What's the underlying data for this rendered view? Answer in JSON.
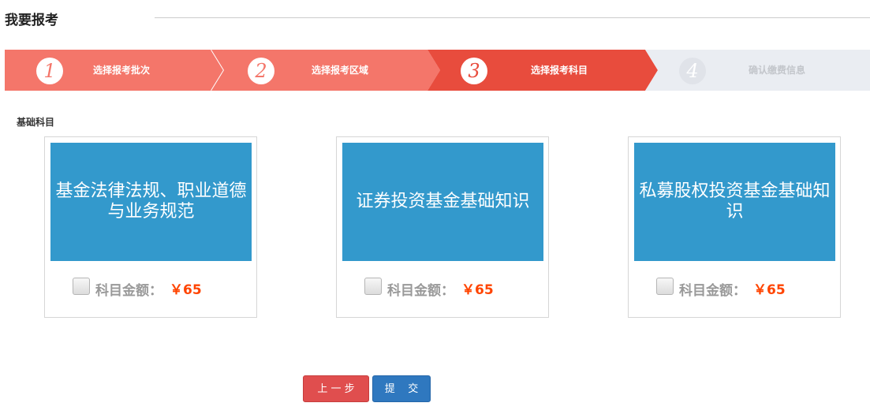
{
  "page_title": "我要报考",
  "steps": [
    {
      "number": "1",
      "label": "选择报考批次",
      "state": "done"
    },
    {
      "number": "2",
      "label": "选择报考区域",
      "state": "done"
    },
    {
      "number": "3",
      "label": "选择报考科目",
      "state": "active"
    },
    {
      "number": "4",
      "label": "确认缴费信息",
      "state": "pending"
    }
  ],
  "colors": {
    "step_done": "#f4766a",
    "step_active": "#e84c3d",
    "step_pending": "#eaedf2",
    "banner": "#3399cc",
    "price": "#ff4400"
  },
  "section_label": "基础科目",
  "subjects": [
    {
      "title": "基金法律法规、职业道德与业务规范",
      "price_label": "科目金额：",
      "price": "￥65",
      "checked": false
    },
    {
      "title": "证券投资基金基础知识",
      "price_label": "科目金额：",
      "price": "￥65",
      "checked": false
    },
    {
      "title": "私募股权投资基金基础知识",
      "price_label": "科目金额：",
      "price": "￥65",
      "checked": false
    }
  ],
  "buttons": {
    "prev_label": "上 一 步",
    "submit_label": "提    交"
  }
}
